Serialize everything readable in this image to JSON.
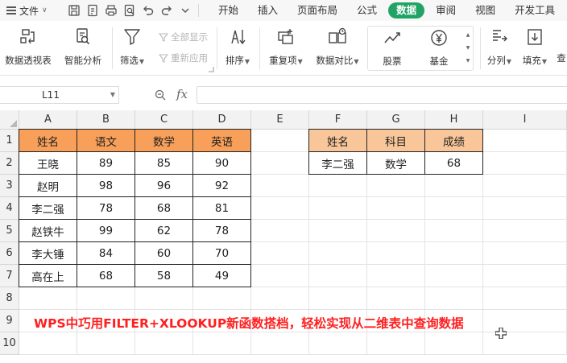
{
  "menubar": {
    "file_label": "文件",
    "tabs": [
      "开始",
      "插入",
      "页面布局",
      "公式",
      "数据",
      "审阅",
      "视图",
      "开发工具"
    ],
    "active_tab": "数据"
  },
  "ribbon": {
    "pivot_table": "数据透视表",
    "smart_analysis": "智能分析",
    "filter": "筛选",
    "show_all": "全部显示",
    "reapply": "重新应用",
    "sort": "排序",
    "duplicates": "重复项",
    "compare": "数据对比",
    "stocks": "股票",
    "funds": "基金",
    "split_column": "分列",
    "fill": "填充",
    "more_cut": "查"
  },
  "formula_bar": {
    "name_box": "L11",
    "fx": "fx",
    "formula": ""
  },
  "sheet": {
    "columns": [
      "A",
      "B",
      "C",
      "D",
      "E",
      "F",
      "G",
      "H",
      "I"
    ],
    "rows": [
      "1",
      "2",
      "3",
      "4",
      "5",
      "6",
      "7",
      "8",
      "9",
      "10"
    ],
    "table1": {
      "headers": [
        "姓名",
        "语文",
        "数学",
        "英语"
      ],
      "rows": [
        [
          "王晓",
          "89",
          "85",
          "90"
        ],
        [
          "赵明",
          "98",
          "96",
          "92"
        ],
        [
          "李二强",
          "78",
          "68",
          "81"
        ],
        [
          "赵铁牛",
          "99",
          "62",
          "78"
        ],
        [
          "李大锤",
          "84",
          "60",
          "70"
        ],
        [
          "高在上",
          "68",
          "58",
          "49"
        ]
      ]
    },
    "table2": {
      "headers": [
        "姓名",
        "科目",
        "成绩"
      ],
      "rows": [
        [
          "李二强",
          "数学",
          "68"
        ]
      ]
    },
    "caption": "WPS中巧用FILTER+XLOOKUP新函数搭档，轻松实现从二维表中查询数据"
  },
  "colors": {
    "active_tab": "#21a366",
    "table1_header": "#f8a05a",
    "table2_header": "#f9c69a",
    "caption": "#ff1f1f"
  }
}
